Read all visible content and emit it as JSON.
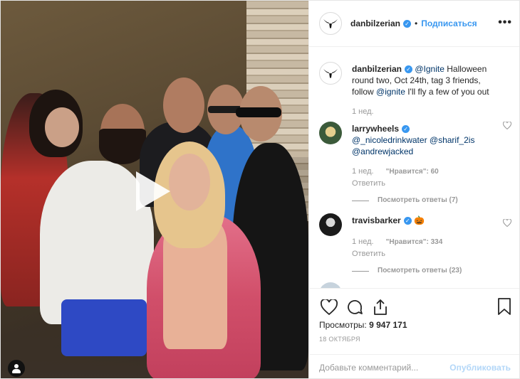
{
  "post": {
    "username": "danbilzerian",
    "follow_label": "Подписаться",
    "more_label": "•••"
  },
  "caption": {
    "username": "danbilzerian",
    "mention1": "@Ignite",
    "text1": " Halloween round two, Oct 24th, tag 3 friends, follow ",
    "mention2": "@ignite",
    "text2": " I'll fly a few of you out",
    "time": "1 нед."
  },
  "comments": [
    {
      "username": "larrywheels",
      "mention1": "@_nicoledrinkwater",
      "mention2": "@sharif_2is",
      "mention3": "@andrewjacked",
      "time": "1 нед.",
      "likes": "\"Нравится\": 60",
      "reply_label": "Ответить",
      "view_replies": "Посмотреть ответы (7)"
    },
    {
      "username": "travisbarker",
      "emoji": "🎃",
      "time": "1 нед.",
      "likes": "\"Нравится\": 334",
      "reply_label": "Ответить",
      "view_replies": "Посмотреть ответы (23)"
    }
  ],
  "stats": {
    "views_label": "Просмотры:",
    "views_value": "9 947 171",
    "date": "18 ОКТЯБРЯ"
  },
  "compose": {
    "placeholder": "Добавьте комментарий...",
    "publish_label": "Опубликовать"
  },
  "icons": {
    "like": "heart-icon",
    "comment": "comment-icon",
    "share": "share-icon",
    "save": "bookmark-icon",
    "play": "play-icon",
    "tagged": "user-tag-icon"
  },
  "colors": {
    "accent": "#3897f0",
    "link": "#003569",
    "muted": "#999999",
    "publish_disabled": "#b3d7f8"
  }
}
